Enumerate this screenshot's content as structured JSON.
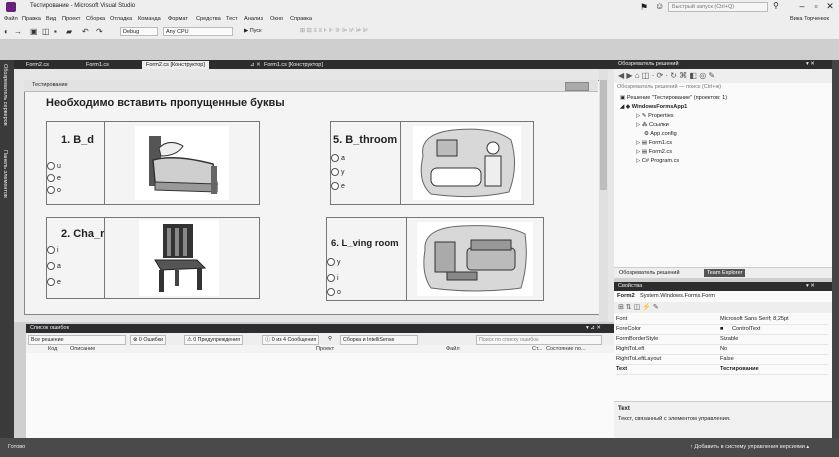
{
  "window": {
    "title": "Тестирование - Microsoft Visual Studio",
    "quick_launch_placeholder": "Быстрый запуск (Ctrl+Q)",
    "user": "Вика Торченюк"
  },
  "menu": [
    "Файл",
    "Правка",
    "Вид",
    "Проект",
    "Сборка",
    "Отладка",
    "Команда",
    "Формат",
    "Средства",
    "Тест",
    "Анализ",
    "Окно",
    "Справка"
  ],
  "toolbar": {
    "config": "Debug",
    "platform": "Any CPU",
    "start": "▶ Пуск"
  },
  "left_strip": [
    "Обозреватель серверов",
    "Панель элементов"
  ],
  "doc_tabs": [
    "Form2.cs",
    "Form1.cs",
    "Form2.cs [Конструктор]",
    "Form1.cs [Конструктор]"
  ],
  "form": {
    "title": "Тестирование",
    "heading": "Необходимо вставить пропущенные буквы",
    "questions": [
      {
        "title": "1. B_d",
        "options": [
          "u",
          "e",
          "o"
        ]
      },
      {
        "title": "2. Cha_r",
        "options": [
          "i",
          "a",
          "e"
        ]
      },
      {
        "title": "5. B_throom",
        "options": [
          "a",
          "y",
          "e"
        ]
      },
      {
        "title": "6. L_ving room",
        "options": [
          "y",
          "i",
          "o"
        ]
      }
    ]
  },
  "error_list": {
    "title": "Список ошибок",
    "scope": "Все решение",
    "errors": "0 Ошибки",
    "warnings": "0 Предупреждения",
    "messages": "0 из 4 Сообщения",
    "build_filter": "Сборка и IntelliSense",
    "search_placeholder": "Поиск по списку ошибок",
    "columns": [
      "Код",
      "Описание",
      "Проект",
      "Файл",
      "Ст...",
      "Состояние по..."
    ]
  },
  "solution_explorer": {
    "title": "Обозреватель решений",
    "search_placeholder": "Обозреватель решений — поиск (Ctrl+ж)",
    "tree": [
      "Решение \"Тестирование\" (проектов: 1)",
      "WindowsFormsApp1",
      "Properties",
      "Ссылки",
      "App.config",
      "Form1.cs",
      "Form2.cs",
      "Program.cs"
    ],
    "tabs": [
      "Обозреватель решений",
      "Team Explorer"
    ]
  },
  "properties": {
    "title": "Свойства",
    "object": "Form2",
    "object_type": "System.Windows.Forms.Form",
    "rows": [
      {
        "name": "Font",
        "value": "Microsoft Sans Serif; 8,25pt"
      },
      {
        "name": "ForeColor",
        "value": "ControlText"
      },
      {
        "name": "FormBorderStyle",
        "value": "Sizable"
      },
      {
        "name": "RightToLeft",
        "value": "No"
      },
      {
        "name": "RightToLeftLayout",
        "value": "False"
      },
      {
        "name": "Text",
        "value": "Тестирование"
      }
    ],
    "desc_title": "Text",
    "desc_text": "Текст, связанный с элементом управления."
  },
  "status": {
    "left": "Готово",
    "right": "↑ Добавить в систему управления версиями ▴"
  }
}
